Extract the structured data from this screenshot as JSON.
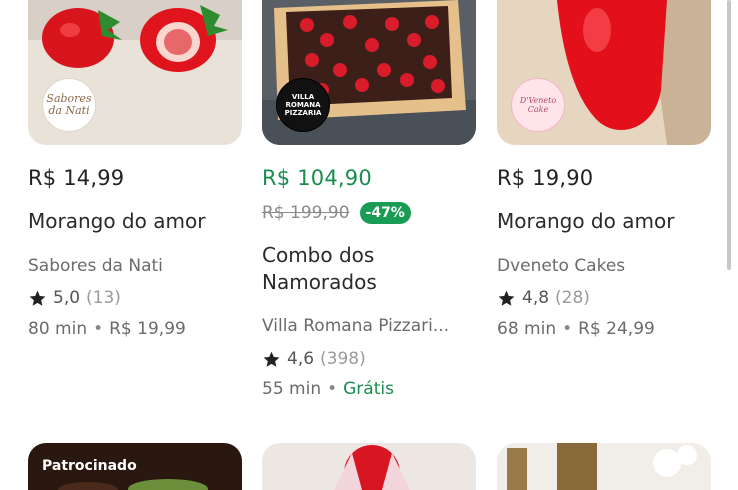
{
  "colors": {
    "promo_green": "#1a8c4e",
    "discount_bg": "#1a9c55",
    "text_dark": "#222222",
    "text_muted": "#6b6b6b"
  },
  "cards": [
    {
      "logo_text": "Sabores da Nati",
      "price": "R$ 14,99",
      "name": "Morango do amor",
      "store": "Sabores da Nati",
      "rating": "5,0",
      "reviews": "(13)",
      "time": "80 min",
      "delivery": "R$ 19,99"
    },
    {
      "logo_text": "VILLA ROMANA PIZZARIA",
      "price": "R$ 104,90",
      "old_price": "R$ 199,90",
      "discount": "-47%",
      "name_line1": "Combo dos",
      "name_line2": "Namorados",
      "store": "Villa Romana Pizzari...",
      "rating": "4,6",
      "reviews": "(398)",
      "time": "55 min",
      "delivery": "Grátis"
    },
    {
      "logo_text": "D'Veneto Cake",
      "price": "R$ 19,90",
      "name": "Morango do amor",
      "store": "Dveneto Cakes",
      "rating": "4,8",
      "reviews": "(28)",
      "time": "68 min",
      "delivery": "R$ 24,99"
    }
  ],
  "next_row": {
    "sponsored_label": "Patrocinado"
  },
  "icons": {
    "rating": "star-icon",
    "separator": "bullet"
  }
}
